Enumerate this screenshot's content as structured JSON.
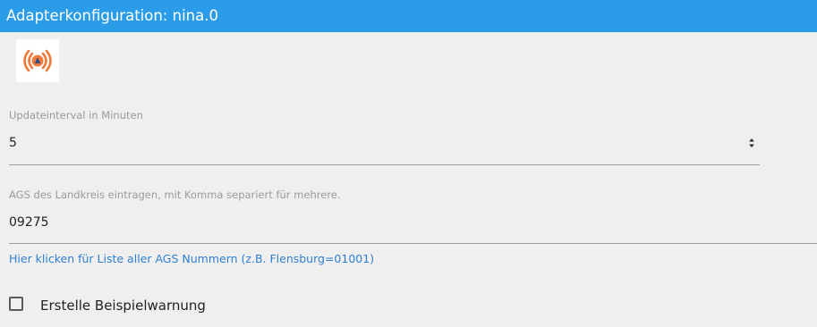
{
  "header": {
    "title": "Adapterkonfiguration: nina.0",
    "background_color": "#2a9ce8"
  },
  "logo": {
    "icon": "siren-broadcast-icon",
    "colors": [
      "#f07a3a",
      "#2a4f8a"
    ]
  },
  "fields": {
    "update_interval": {
      "label": "Updateinterval in Minuten",
      "value": "5",
      "type": "number"
    },
    "ags": {
      "label": "AGS des Landkreis eintragen, mit Komma separiert für mehrere.",
      "value": "09275"
    }
  },
  "link": {
    "text": "Hier klicken für Liste aller AGS Nummern (z.B. Flensburg=01001)",
    "color": "#2f7fd0"
  },
  "checkbox": {
    "label": "Erstelle Beispielwarnung",
    "checked": false
  }
}
